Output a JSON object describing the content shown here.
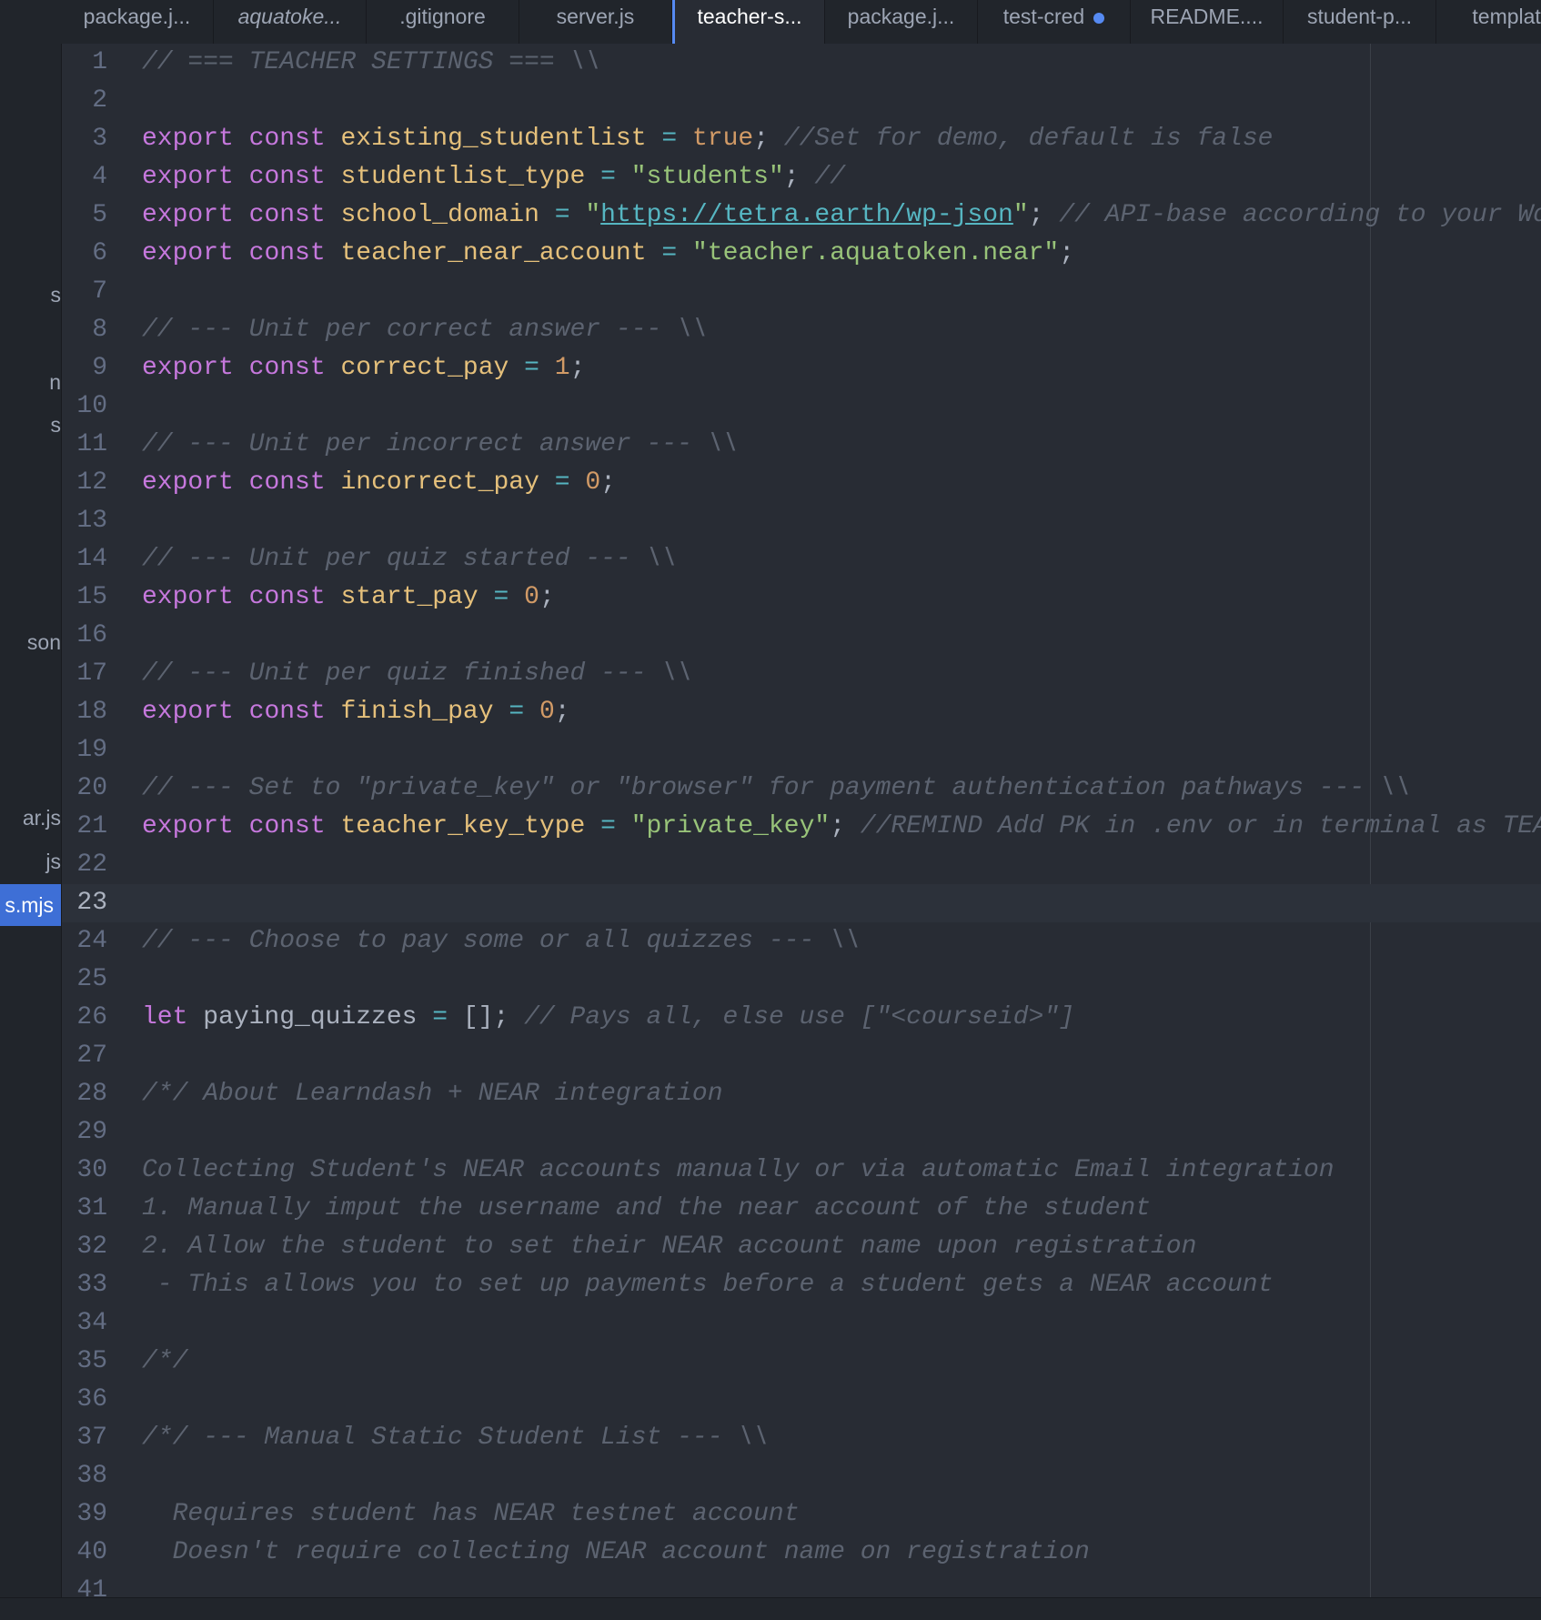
{
  "sidebar": {
    "items": [
      {
        "label": "s"
      },
      {
        "label": "n"
      },
      {
        "label": "s"
      },
      {
        "label": "son"
      },
      {
        "label": "ar.js"
      },
      {
        "label": "js"
      },
      {
        "label": "s.mjs",
        "selected": true
      }
    ]
  },
  "tabs": [
    {
      "label": "package.j...",
      "italic": false
    },
    {
      "label": "aquatoke...",
      "italic": true
    },
    {
      "label": ".gitignore",
      "italic": false
    },
    {
      "label": "server.js",
      "italic": false
    },
    {
      "label": "teacher-s...",
      "italic": false,
      "active": true
    },
    {
      "label": "package.j...",
      "italic": false
    },
    {
      "label": "test-cred",
      "italic": false,
      "modified": true
    },
    {
      "label": "README....",
      "italic": false
    },
    {
      "label": "student-p...",
      "italic": false
    },
    {
      "label": "template",
      "italic": false
    }
  ],
  "editor": {
    "cursor_line": 23,
    "lines": [
      {
        "n": "1",
        "tokens": [
          {
            "t": "com",
            "v": "// === TEACHER SETTINGS === \\\\"
          }
        ]
      },
      {
        "n": "2",
        "tokens": []
      },
      {
        "n": "3",
        "tokens": [
          {
            "t": "kw",
            "v": "export"
          },
          {
            "t": "plain",
            "v": " "
          },
          {
            "t": "kw",
            "v": "const"
          },
          {
            "t": "plain",
            "v": " "
          },
          {
            "t": "var",
            "v": "existing_studentlist"
          },
          {
            "t": "plain",
            "v": " "
          },
          {
            "t": "op",
            "v": "="
          },
          {
            "t": "plain",
            "v": " "
          },
          {
            "t": "num",
            "v": "true"
          },
          {
            "t": "plain",
            "v": "; "
          },
          {
            "t": "com",
            "v": "//Set for demo, default is false"
          }
        ]
      },
      {
        "n": "4",
        "tokens": [
          {
            "t": "kw",
            "v": "export"
          },
          {
            "t": "plain",
            "v": " "
          },
          {
            "t": "kw",
            "v": "const"
          },
          {
            "t": "plain",
            "v": " "
          },
          {
            "t": "var",
            "v": "studentlist_type"
          },
          {
            "t": "plain",
            "v": " "
          },
          {
            "t": "op",
            "v": "="
          },
          {
            "t": "plain",
            "v": " "
          },
          {
            "t": "str",
            "v": "\"students\""
          },
          {
            "t": "plain",
            "v": "; "
          },
          {
            "t": "com",
            "v": "//"
          }
        ]
      },
      {
        "n": "5",
        "tokens": [
          {
            "t": "kw",
            "v": "export"
          },
          {
            "t": "plain",
            "v": " "
          },
          {
            "t": "kw",
            "v": "const"
          },
          {
            "t": "plain",
            "v": " "
          },
          {
            "t": "var",
            "v": "school_domain"
          },
          {
            "t": "plain",
            "v": " "
          },
          {
            "t": "op",
            "v": "="
          },
          {
            "t": "plain",
            "v": " "
          },
          {
            "t": "str",
            "v": "\""
          },
          {
            "t": "url",
            "v": "https://tetra.earth/wp-json"
          },
          {
            "t": "str",
            "v": "\""
          },
          {
            "t": "plain",
            "v": "; "
          },
          {
            "t": "com",
            "v": "// API-base according to your Wo"
          }
        ]
      },
      {
        "n": "6",
        "tokens": [
          {
            "t": "kw",
            "v": "export"
          },
          {
            "t": "plain",
            "v": " "
          },
          {
            "t": "kw",
            "v": "const"
          },
          {
            "t": "plain",
            "v": " "
          },
          {
            "t": "var",
            "v": "teacher_near_account"
          },
          {
            "t": "plain",
            "v": " "
          },
          {
            "t": "op",
            "v": "="
          },
          {
            "t": "plain",
            "v": " "
          },
          {
            "t": "str",
            "v": "\"teacher.aquatoken.near\""
          },
          {
            "t": "plain",
            "v": ";"
          }
        ]
      },
      {
        "n": "7",
        "tokens": []
      },
      {
        "n": "8",
        "tokens": [
          {
            "t": "com",
            "v": "// --- Unit per correct answer --- \\\\"
          }
        ]
      },
      {
        "n": "9",
        "tokens": [
          {
            "t": "kw",
            "v": "export"
          },
          {
            "t": "plain",
            "v": " "
          },
          {
            "t": "kw",
            "v": "const"
          },
          {
            "t": "plain",
            "v": " "
          },
          {
            "t": "var",
            "v": "correct_pay"
          },
          {
            "t": "plain",
            "v": " "
          },
          {
            "t": "op",
            "v": "="
          },
          {
            "t": "plain",
            "v": " "
          },
          {
            "t": "num",
            "v": "1"
          },
          {
            "t": "plain",
            "v": ";"
          }
        ]
      },
      {
        "n": "10",
        "tokens": []
      },
      {
        "n": "11",
        "tokens": [
          {
            "t": "com",
            "v": "// --- Unit per incorrect answer --- \\\\"
          }
        ]
      },
      {
        "n": "12",
        "tokens": [
          {
            "t": "kw",
            "v": "export"
          },
          {
            "t": "plain",
            "v": " "
          },
          {
            "t": "kw",
            "v": "const"
          },
          {
            "t": "plain",
            "v": " "
          },
          {
            "t": "var",
            "v": "incorrect_pay"
          },
          {
            "t": "plain",
            "v": " "
          },
          {
            "t": "op",
            "v": "="
          },
          {
            "t": "plain",
            "v": " "
          },
          {
            "t": "num",
            "v": "0"
          },
          {
            "t": "plain",
            "v": ";"
          }
        ]
      },
      {
        "n": "13",
        "tokens": []
      },
      {
        "n": "14",
        "tokens": [
          {
            "t": "com",
            "v": "// --- Unit per quiz started --- \\\\"
          }
        ]
      },
      {
        "n": "15",
        "tokens": [
          {
            "t": "kw",
            "v": "export"
          },
          {
            "t": "plain",
            "v": " "
          },
          {
            "t": "kw",
            "v": "const"
          },
          {
            "t": "plain",
            "v": " "
          },
          {
            "t": "var",
            "v": "start_pay"
          },
          {
            "t": "plain",
            "v": " "
          },
          {
            "t": "op",
            "v": "="
          },
          {
            "t": "plain",
            "v": " "
          },
          {
            "t": "num",
            "v": "0"
          },
          {
            "t": "plain",
            "v": ";"
          }
        ]
      },
      {
        "n": "16",
        "tokens": []
      },
      {
        "n": "17",
        "tokens": [
          {
            "t": "com",
            "v": "// --- Unit per quiz finished --- \\\\"
          }
        ]
      },
      {
        "n": "18",
        "tokens": [
          {
            "t": "kw",
            "v": "export"
          },
          {
            "t": "plain",
            "v": " "
          },
          {
            "t": "kw",
            "v": "const"
          },
          {
            "t": "plain",
            "v": " "
          },
          {
            "t": "var",
            "v": "finish_pay"
          },
          {
            "t": "plain",
            "v": " "
          },
          {
            "t": "op",
            "v": "="
          },
          {
            "t": "plain",
            "v": " "
          },
          {
            "t": "num",
            "v": "0"
          },
          {
            "t": "plain",
            "v": ";"
          }
        ]
      },
      {
        "n": "19",
        "tokens": []
      },
      {
        "n": "20",
        "tokens": [
          {
            "t": "com",
            "v": "// --- Set to \"private_key\" or \"browser\" for payment authentication pathways --- \\\\"
          }
        ]
      },
      {
        "n": "21",
        "tokens": [
          {
            "t": "kw",
            "v": "export"
          },
          {
            "t": "plain",
            "v": " "
          },
          {
            "t": "kw",
            "v": "const"
          },
          {
            "t": "plain",
            "v": " "
          },
          {
            "t": "var",
            "v": "teacher_key_type"
          },
          {
            "t": "plain",
            "v": " "
          },
          {
            "t": "op",
            "v": "="
          },
          {
            "t": "plain",
            "v": " "
          },
          {
            "t": "str",
            "v": "\"private_key\""
          },
          {
            "t": "plain",
            "v": "; "
          },
          {
            "t": "com",
            "v": "//REMIND Add PK in .env or in terminal as TEA"
          }
        ]
      },
      {
        "n": "22",
        "tokens": []
      },
      {
        "n": "23",
        "tokens": []
      },
      {
        "n": "24",
        "tokens": [
          {
            "t": "com",
            "v": "// --- Choose to pay some or all quizzes --- \\\\"
          }
        ]
      },
      {
        "n": "25",
        "tokens": []
      },
      {
        "n": "26",
        "tokens": [
          {
            "t": "kw",
            "v": "let"
          },
          {
            "t": "plain",
            "v": " paying_quizzes "
          },
          {
            "t": "op",
            "v": "="
          },
          {
            "t": "plain",
            "v": " []; "
          },
          {
            "t": "com",
            "v": "// Pays all, else use [\"<courseid>\"]"
          }
        ]
      },
      {
        "n": "27",
        "tokens": []
      },
      {
        "n": "28",
        "tokens": [
          {
            "t": "com",
            "v": "/*/ About Learndash + NEAR integration"
          }
        ]
      },
      {
        "n": "29",
        "tokens": []
      },
      {
        "n": "30",
        "tokens": [
          {
            "t": "com",
            "v": "Collecting Student's NEAR accounts manually or via automatic Email integration"
          }
        ]
      },
      {
        "n": "31",
        "tokens": [
          {
            "t": "com",
            "v": "1. Manually imput the username and the near account of the student"
          }
        ]
      },
      {
        "n": "32",
        "tokens": [
          {
            "t": "com",
            "v": "2. Allow the student to set their NEAR account name upon registration"
          }
        ]
      },
      {
        "n": "33",
        "tokens": [
          {
            "t": "com",
            "v": " - This allows you to set up payments before a student gets a NEAR account"
          }
        ]
      },
      {
        "n": "34",
        "tokens": []
      },
      {
        "n": "35",
        "tokens": [
          {
            "t": "com",
            "v": "/*/"
          }
        ]
      },
      {
        "n": "36",
        "tokens": []
      },
      {
        "n": "37",
        "tokens": [
          {
            "t": "com",
            "v": "/*/ --- Manual Static Student List --- \\\\"
          }
        ]
      },
      {
        "n": "38",
        "tokens": []
      },
      {
        "n": "39",
        "tokens": [
          {
            "t": "com",
            "v": "  Requires student has NEAR testnet account"
          }
        ]
      },
      {
        "n": "40",
        "tokens": [
          {
            "t": "com",
            "v": "  Doesn't require collecting NEAR account name on registration"
          }
        ]
      },
      {
        "n": "41",
        "tokens": []
      }
    ]
  }
}
